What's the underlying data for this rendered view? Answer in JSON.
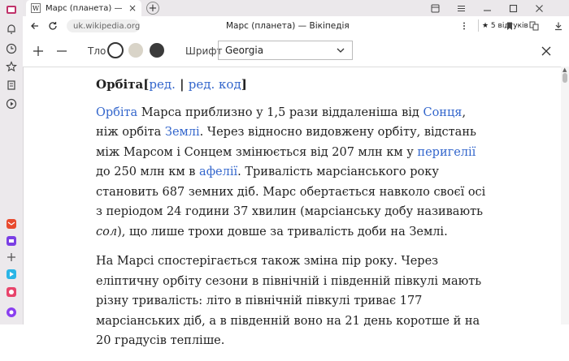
{
  "tab": {
    "title": "Марс (планета) — Вікіпедія",
    "favicon": "W"
  },
  "address": {
    "url": "uk.wikipedia.org",
    "page_title": "Марс (планета) — Вікіпедія",
    "reviews": "★ 5 відгуків"
  },
  "reader": {
    "background_label": "Тло",
    "font_label": "Шрифт",
    "font_value": "Georgia",
    "swatches": [
      "#ffffff",
      "#d9d4c8",
      "#3a3a3a"
    ]
  },
  "article": {
    "heading": "Орбіта",
    "edit": "ред.",
    "separator": " | ",
    "edit_code": "ред. код",
    "p1": {
      "link_orbit": "Орбіта",
      "t1": " Марса приблизно у 1,5 рази віддаленіша від ",
      "link_sun": "Сонця",
      "t2": ", ніж орбіта ",
      "link_earth": "Землі",
      "t3": ". Через відносно видовжену орбіту, відстань між Марсом і Сонцем змінюється від 207 млн км у ",
      "link_perihelion": "перигелії",
      "t4": " до 250 млн км в ",
      "link_aphelion": "афелії",
      "t5": ". Тривалість марсіанського року становить 687 земних діб. Марс обертається навколо своєї осі з періодом 24 години 37 хвилин (марсіанську добу називають ",
      "sol": "сол",
      "t6": "), що лише трохи довше за тривалість доби на Землі."
    },
    "p2": "На Марсі спостерігається також зміна пір року. Через еліптичну орбіту сезони в північній і південній півкулі мають різну тривалість: літо в північній півкулі триває 177 марсіанських діб, а в південній воно на 21 день коротше й на 20 градусів тепліше."
  },
  "colors": {
    "accent_link": "#3366cc",
    "sidebar_bg": "#ece9ec"
  }
}
